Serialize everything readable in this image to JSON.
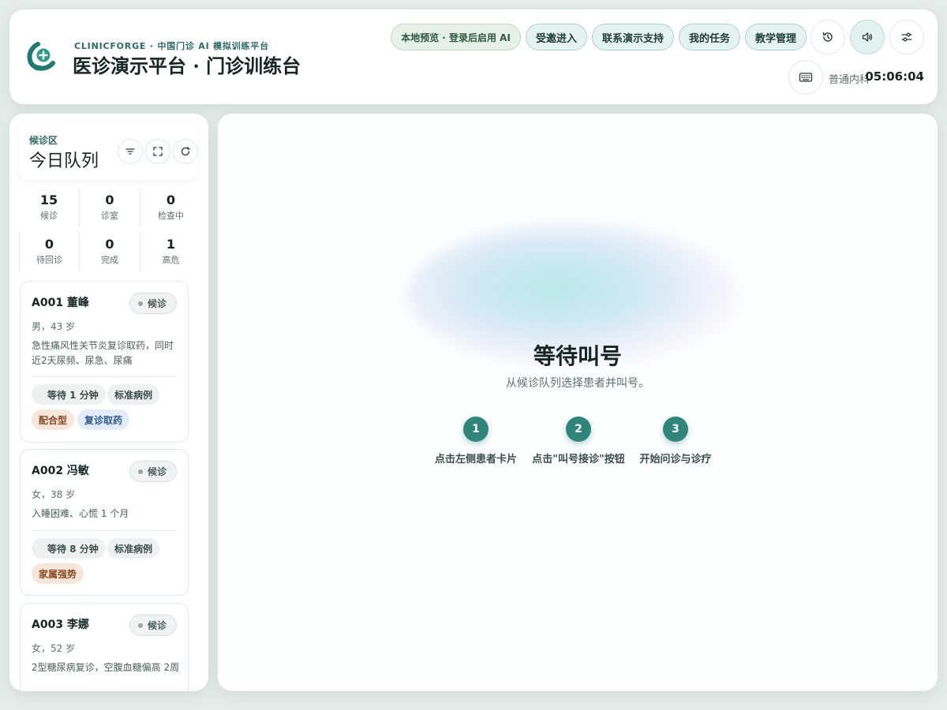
{
  "header": {
    "brand_sub": "CLINICFORGE · 中国门诊 AI 模拟训练平台",
    "title": "医诊演示平台 · 门诊训练台",
    "nav": [
      "本地预览 · 登录后启用 AI",
      "受邀进入",
      "联系演示支持",
      "我的任务",
      "教学管理"
    ],
    "icons": [
      "history-icon",
      "speaker-icon",
      "sliders-icon",
      "keyboard-icon"
    ],
    "department": "普通内科",
    "clock": "05:06:04"
  },
  "sidebar": {
    "eyebrow": "候诊区",
    "title": "今日队列",
    "tool_icons": [
      "filter-icon",
      "expand-icon",
      "refresh-icon"
    ],
    "stats": [
      {
        "value": "15",
        "label": "候诊"
      },
      {
        "value": "0",
        "label": "诊室"
      },
      {
        "value": "0",
        "label": "检查中"
      },
      {
        "value": "0",
        "label": "待回诊"
      },
      {
        "value": "0",
        "label": "完成"
      },
      {
        "value": "1",
        "label": "高危"
      }
    ],
    "patients": [
      {
        "name": "A001 董峰",
        "status": "候诊",
        "demo": "男，43 岁",
        "complaint": "急性痛风性关节炎复诊取药，同时近2天尿频、尿急、尿痛",
        "wait": "等待 1 分钟",
        "tags": [
          "标准病例",
          "配合型",
          "复诊取药"
        ]
      },
      {
        "name": "A002 冯敏",
        "status": "候诊",
        "demo": "女，38 岁",
        "complaint": "入睡困难、心慌 1 个月",
        "wait": "等待 8 分钟",
        "tags": [
          "标准病例",
          "家属强势"
        ]
      },
      {
        "name": "A003 李娜",
        "status": "候诊",
        "demo": "女，52 岁",
        "complaint": "2型糖尿病复诊，空腹血糖偏高 2周"
      }
    ]
  },
  "main": {
    "empty_title": "等待叫号",
    "empty_subtitle": "从候诊队列选择患者并叫号。",
    "steps": [
      {
        "num": "1",
        "label": "点击左侧患者卡片"
      },
      {
        "num": "2",
        "label": "点击\"叫号接诊\"按钮"
      },
      {
        "num": "3",
        "label": "开始问诊与诊疗"
      }
    ]
  },
  "colors": {
    "accent": "#2f857a",
    "brand_text": "#2c6b64",
    "tag_peach": "#f7e6da",
    "tag_blue": "#e2ebf8"
  }
}
